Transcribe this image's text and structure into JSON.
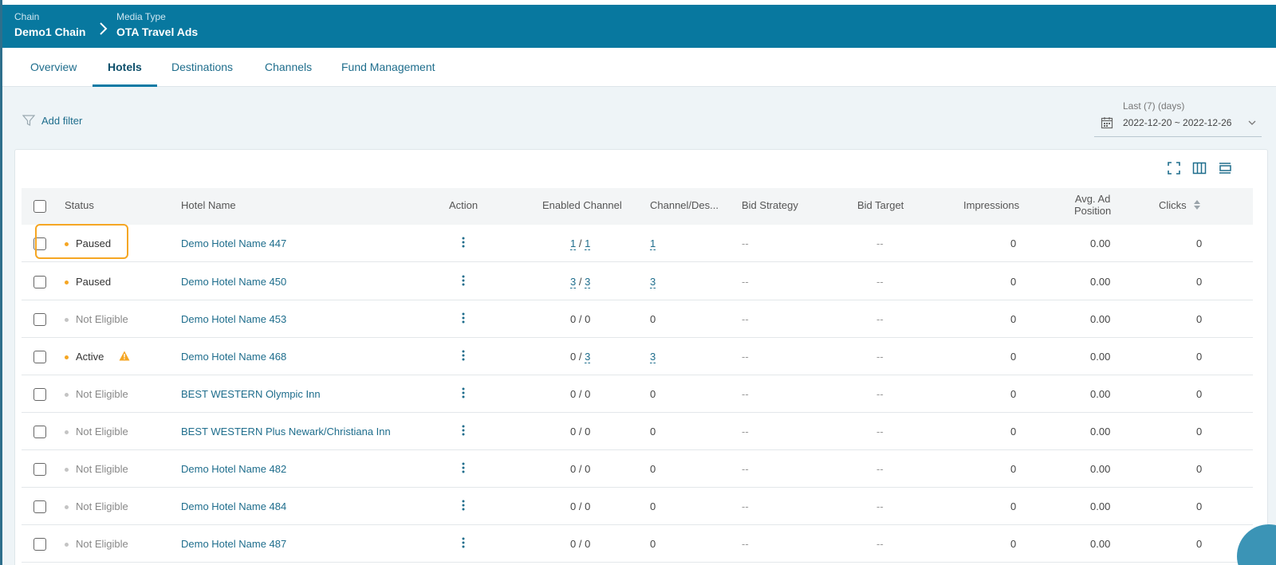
{
  "breadcrumb": {
    "chain_label": "Chain",
    "chain_value": "Demo1 Chain",
    "media_label": "Media Type",
    "media_value": "OTA Travel Ads"
  },
  "tabs": [
    {
      "label": "Overview",
      "active": false
    },
    {
      "label": "Hotels",
      "active": true
    },
    {
      "label": "Destinations",
      "active": false
    },
    {
      "label": "Channels",
      "active": false
    },
    {
      "label": "Fund Management",
      "active": false
    }
  ],
  "filter": {
    "label": "Add filter"
  },
  "date_range": {
    "period": "Last (7) (days)",
    "range": "2022-12-20 ~ 2022-12-26"
  },
  "table": {
    "headers": {
      "status": "Status",
      "hotel_name": "Hotel Name",
      "action": "Action",
      "enabled_channel": "Enabled Channel",
      "channel_des": "Channel/Des...",
      "bid_strategy": "Bid Strategy",
      "bid_target": "Bid Target",
      "impressions": "Impressions",
      "avg_ad_position_1": "Avg. Ad",
      "avg_ad_position_2": "Position",
      "clicks": "Clicks"
    },
    "rows": [
      {
        "status": "Paused",
        "status_color": "#f5a623",
        "hotel": "Demo Hotel Name 447",
        "ec_a": "1",
        "ec_b": "1",
        "ec_links": true,
        "channel_des": "1",
        "cd_link": true,
        "bid_strategy": "--",
        "bid_target": "--",
        "impressions": "0",
        "avg_pos": "0.00",
        "clicks": "0",
        "warning": false
      },
      {
        "status": "Paused",
        "status_color": "#f5a623",
        "hotel": "Demo Hotel Name 450",
        "ec_a": "3",
        "ec_b": "3",
        "ec_links": true,
        "channel_des": "3",
        "cd_link": true,
        "bid_strategy": "--",
        "bid_target": "--",
        "impressions": "0",
        "avg_pos": "0.00",
        "clicks": "0",
        "warning": false
      },
      {
        "status": "Not Eligible",
        "status_color": "#c4c4c4",
        "hotel": "Demo Hotel Name 453",
        "ec_a": "0",
        "ec_b": "0",
        "ec_links": false,
        "channel_des": "0",
        "cd_link": false,
        "bid_strategy": "--",
        "bid_target": "--",
        "impressions": "0",
        "avg_pos": "0.00",
        "clicks": "0",
        "warning": false
      },
      {
        "status": "Active",
        "status_color": "#f5a623",
        "hotel": "Demo Hotel Name 468",
        "ec_a": "0",
        "ec_b": "3",
        "ec_links": "b",
        "channel_des": "3",
        "cd_link": true,
        "bid_strategy": "--",
        "bid_target": "--",
        "impressions": "0",
        "avg_pos": "0.00",
        "clicks": "0",
        "warning": true
      },
      {
        "status": "Not Eligible",
        "status_color": "#c4c4c4",
        "hotel": "BEST WESTERN Olympic Inn",
        "ec_a": "0",
        "ec_b": "0",
        "ec_links": false,
        "channel_des": "0",
        "cd_link": false,
        "bid_strategy": "--",
        "bid_target": "--",
        "impressions": "0",
        "avg_pos": "0.00",
        "clicks": "0",
        "warning": false
      },
      {
        "status": "Not Eligible",
        "status_color": "#c4c4c4",
        "hotel": "BEST WESTERN Plus Newark/Christiana Inn",
        "ec_a": "0",
        "ec_b": "0",
        "ec_links": false,
        "channel_des": "0",
        "cd_link": false,
        "bid_strategy": "--",
        "bid_target": "--",
        "impressions": "0",
        "avg_pos": "0.00",
        "clicks": "0",
        "warning": false
      },
      {
        "status": "Not Eligible",
        "status_color": "#c4c4c4",
        "hotel": "Demo Hotel Name 482",
        "ec_a": "0",
        "ec_b": "0",
        "ec_links": false,
        "channel_des": "0",
        "cd_link": false,
        "bid_strategy": "--",
        "bid_target": "--",
        "impressions": "0",
        "avg_pos": "0.00",
        "clicks": "0",
        "warning": false
      },
      {
        "status": "Not Eligible",
        "status_color": "#c4c4c4",
        "hotel": "Demo Hotel Name 484",
        "ec_a": "0",
        "ec_b": "0",
        "ec_links": false,
        "channel_des": "0",
        "cd_link": false,
        "bid_strategy": "--",
        "bid_target": "--",
        "impressions": "0",
        "avg_pos": "0.00",
        "clicks": "0",
        "warning": false
      },
      {
        "status": "Not Eligible",
        "status_color": "#c4c4c4",
        "hotel": "Demo Hotel Name 487",
        "ec_a": "0",
        "ec_b": "0",
        "ec_links": false,
        "channel_des": "0",
        "cd_link": false,
        "bid_strategy": "--",
        "bid_target": "--",
        "impressions": "0",
        "avg_pos": "0.00",
        "clicks": "0",
        "warning": false
      }
    ]
  },
  "colors": {
    "header_bg": "#08789f",
    "link": "#1e6d8c",
    "paused_dot": "#f5a623",
    "inactive_dot": "#c4c4c4",
    "highlight": "#f5a623"
  }
}
